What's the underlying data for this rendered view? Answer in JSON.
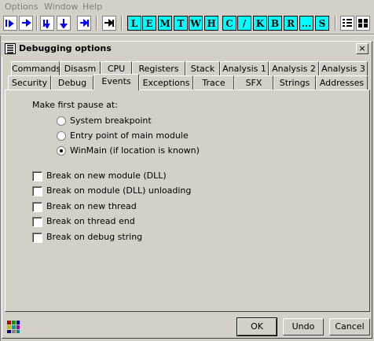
{
  "menu": {
    "commands": "Options",
    "window": "Window",
    "help": "Help"
  },
  "toolbar": {
    "letters": [
      "L",
      "E",
      "M",
      "T",
      "W",
      "H",
      "C",
      "/",
      "K",
      "B",
      "R",
      "...",
      "S"
    ]
  },
  "dialog": {
    "title": "Debugging options",
    "close": "×",
    "tabs_row1": [
      "Commands",
      "Disasm",
      "CPU",
      "Registers",
      "Stack",
      "Analysis 1",
      "Analysis 2",
      "Analysis 3"
    ],
    "tabs_row2": [
      "Security",
      "Debug",
      "Events",
      "Exceptions",
      "Trace",
      "SFX",
      "Strings",
      "Addresses"
    ],
    "active_tab": "Events",
    "first_pause": {
      "heading": "Make first pause at:",
      "options": [
        "System breakpoint",
        "Entry point of main module",
        "WinMain (if location is known)"
      ],
      "selected": "WinMain (if location is known)"
    },
    "checkboxes": [
      {
        "label": "Break on new module (DLL)",
        "checked": false
      },
      {
        "label": "Break on module (DLL) unloading",
        "checked": false
      },
      {
        "label": "Break on new thread",
        "checked": false
      },
      {
        "label": "Break on thread end",
        "checked": false
      },
      {
        "label": "Break on debug string",
        "checked": false
      }
    ],
    "buttons": {
      "ok": "OK",
      "undo": "Undo",
      "cancel": "Cancel"
    }
  }
}
